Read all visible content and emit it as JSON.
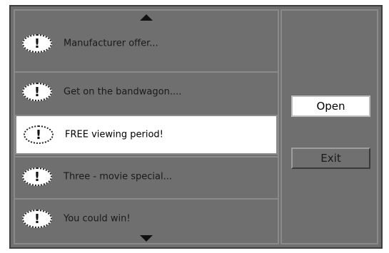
{
  "list": {
    "items": [
      {
        "label": "Manufacturer offer...",
        "icon": "exclamation-icon",
        "selected": false
      },
      {
        "label": "Get on the bandwagon....",
        "icon": "exclamation-icon",
        "selected": false
      },
      {
        "label": "FREE viewing period!",
        "icon": "exclamation-icon",
        "selected": true
      },
      {
        "label": "Three - movie special...",
        "icon": "exclamation-icon",
        "selected": false
      },
      {
        "label": "You could win!",
        "icon": "exclamation-icon",
        "selected": false
      }
    ],
    "icon_glyph": "!"
  },
  "buttons": {
    "open_label": "Open",
    "exit_label": "Exit"
  },
  "colors": {
    "background": "#6f6f6f",
    "selected": "#ffffff"
  }
}
